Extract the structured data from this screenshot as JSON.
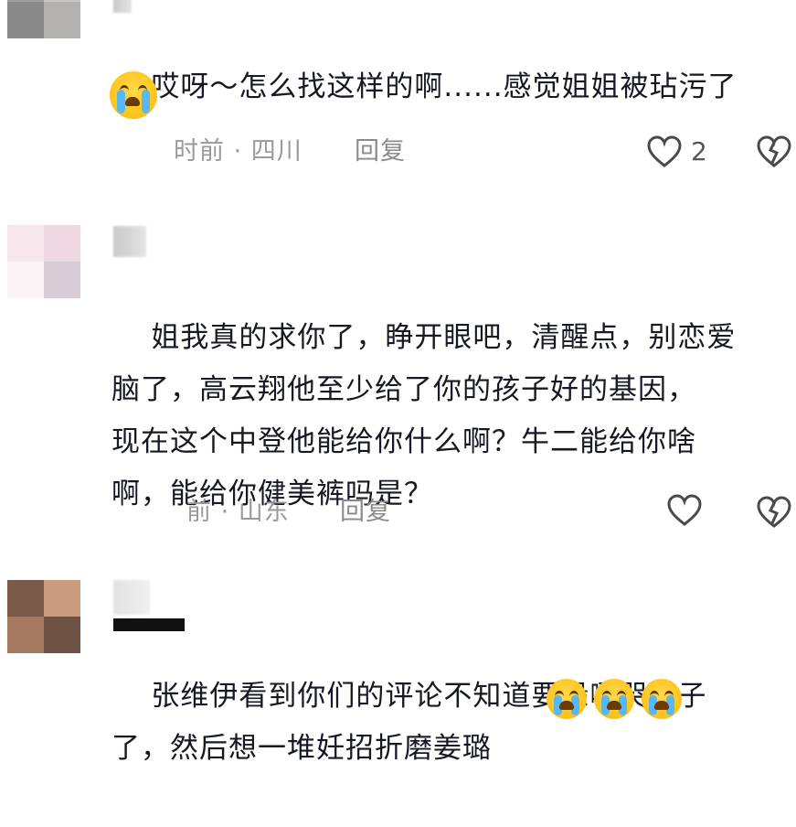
{
  "comments": [
    {
      "text": "哎呀～怎么找这样的啊......感觉姐姐被玷污了",
      "emoji": "crying-emoji",
      "time": "时前",
      "location": "四川",
      "reply_label": "回复",
      "like_count": "2"
    },
    {
      "text": "姐我真的求你了，睁开眼吧，清醒点，别恋爱\n脑了，高云翔他至少给了你的孩子好的基因，\n现在这个中登他能给你什么啊？牛二能给你啥\n啊，能给你健美裤吗是？",
      "time": "前",
      "location": "山东",
      "reply_label": "回复",
      "like_count": ""
    },
    {
      "text": "张维伊看到你们的评论不知道要躲哪哭鼻子\n了，然后想一堆妊招折磨姜璐",
      "emoji": "crying-emoji"
    }
  ],
  "colors": {
    "text": "#161823",
    "meta": "#9a9a9a",
    "icon": "#4a4a4a"
  }
}
